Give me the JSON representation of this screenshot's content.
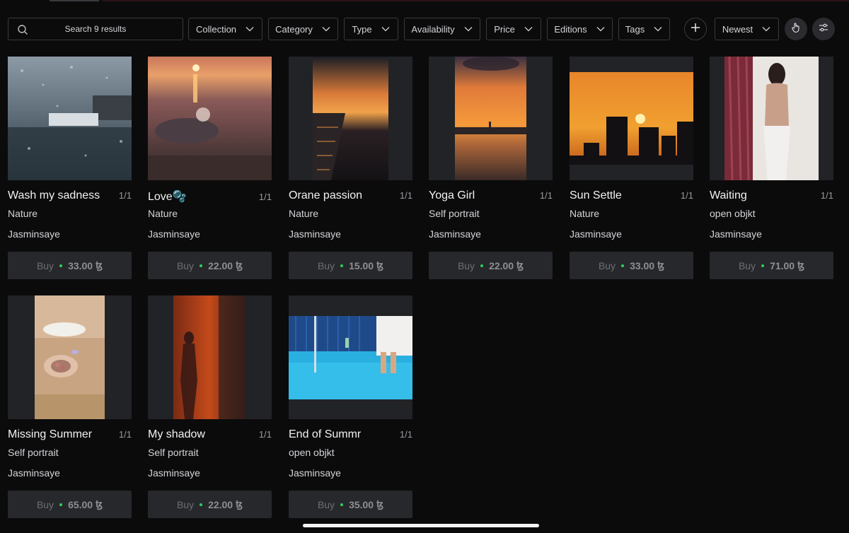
{
  "search": {
    "label": "Search 9 results"
  },
  "filters": [
    {
      "label": "Collection"
    },
    {
      "label": "Category"
    },
    {
      "label": "Type"
    },
    {
      "label": "Availability"
    },
    {
      "label": "Price"
    },
    {
      "label": "Editions"
    },
    {
      "label": "Tags"
    }
  ],
  "sort": {
    "label": "Newest"
  },
  "icons": {
    "add": "plus-icon",
    "pointer": "hand-pointer-icon",
    "settings": "sliders-icon"
  },
  "colors": {
    "background": "#0b0b0c",
    "button": "#27282b",
    "accent_dot": "#2fd05c"
  },
  "items": [
    {
      "title": "Wash my sadness",
      "editions": "1/1",
      "category": "Nature",
      "artist": "Jasminsaye",
      "buy": "Buy",
      "price": "33.00",
      "currency": "ꜩ"
    },
    {
      "title": "Love🫧",
      "editions": "1/1",
      "category": "Nature",
      "artist": "Jasminsaye",
      "buy": "Buy",
      "price": "22.00",
      "currency": "ꜩ"
    },
    {
      "title": "Orane passion",
      "editions": "1/1",
      "category": "Nature",
      "artist": "Jasminsaye",
      "buy": "Buy",
      "price": "15.00",
      "currency": "ꜩ"
    },
    {
      "title": "Yoga Girl",
      "editions": "1/1",
      "category": "Self portrait",
      "artist": "Jasminsaye",
      "buy": "Buy",
      "price": "22.00",
      "currency": "ꜩ"
    },
    {
      "title": "Sun Settle",
      "editions": "1/1",
      "category": "Nature",
      "artist": "Jasminsaye",
      "buy": "Buy",
      "price": "33.00",
      "currency": "ꜩ"
    },
    {
      "title": "Waiting",
      "editions": "1/1",
      "category": "open objkt",
      "artist": "Jasminsaye",
      "buy": "Buy",
      "price": "71.00",
      "currency": "ꜩ"
    },
    {
      "title": "Missing Summer",
      "editions": "1/1",
      "category": "Self portrait",
      "artist": "Jasminsaye",
      "buy": "Buy",
      "price": "65.00",
      "currency": "ꜩ"
    },
    {
      "title": "My shadow",
      "editions": "1/1",
      "category": "Self portrait",
      "artist": "Jasminsaye",
      "buy": "Buy",
      "price": "22.00",
      "currency": "ꜩ"
    },
    {
      "title": "End of Summr",
      "editions": "1/1",
      "category": "open objkt",
      "artist": "Jasminsaye",
      "buy": "Buy",
      "price": "35.00",
      "currency": "ꜩ"
    }
  ]
}
